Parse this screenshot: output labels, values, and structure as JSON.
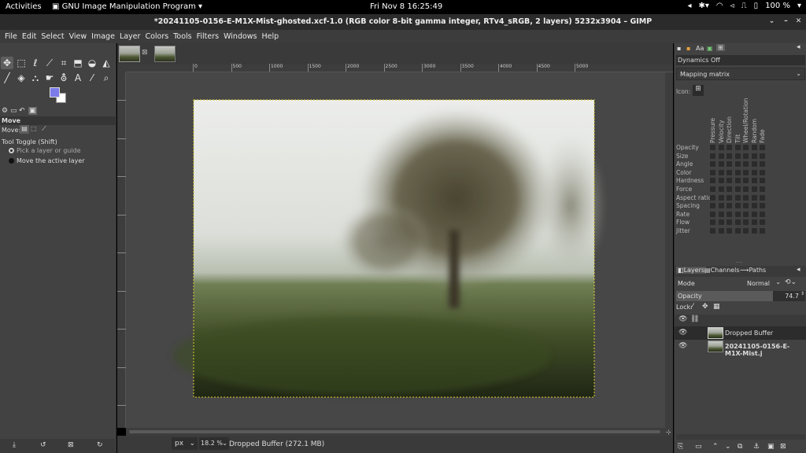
{
  "system_bar": {
    "activities": "Activities",
    "app_name": "GNU Image Manipulation Program",
    "clock": "Fri Nov 8  16:25:49",
    "battery": "100 %"
  },
  "window": {
    "title": "*20241105-0156-E-M1X-Mist-ghosted.xcf-1.0 (RGB color 8-bit gamma integer, RTv4_sRGB, 2 layers) 5232x3904 – GIMP"
  },
  "menu": [
    "File",
    "Edit",
    "Select",
    "View",
    "Image",
    "Layer",
    "Colors",
    "Tools",
    "Filters",
    "Windows",
    "Help"
  ],
  "tool_options": {
    "title": "Move",
    "move_label": "Move:",
    "toggle_label": "Tool Toggle  (Shift)",
    "option1": "Pick a layer or guide",
    "option2": "Move the active layer"
  },
  "ruler_ticks": [
    "0",
    "500",
    "1000",
    "1500",
    "2000",
    "2500",
    "3000",
    "3500",
    "4000",
    "4500",
    "5000"
  ],
  "status": {
    "unit": "px",
    "zoom": "18.2 %",
    "message": "Dropped Buffer (272.1 MB)"
  },
  "paint_dynamics": {
    "name": "Dynamics Off",
    "mode": "Mapping matrix",
    "icon_label": "Icon:",
    "columns": [
      "Pressure",
      "Velocity",
      "Direction",
      "Tilt",
      "Wheel/Rotation",
      "Random",
      "Fade"
    ],
    "rows": [
      "Opacity",
      "Size",
      "Angle",
      "Color",
      "Hardness",
      "Force",
      "Aspect ratio",
      "Spacing",
      "Rate",
      "Flow",
      "Jitter"
    ]
  },
  "layers_panel": {
    "tabs": [
      "Layers",
      "Channels",
      "Paths"
    ],
    "mode_label": "Mode",
    "mode_value": "Normal",
    "opacity_label": "Opacity",
    "opacity_value": "74.7",
    "opacity_fraction": 0.747,
    "lock_label": "Lock:",
    "layers": [
      {
        "name": "Dropped Buffer"
      },
      {
        "name": "20241105-0156-E-M1X-Mist.j"
      }
    ]
  },
  "colors": {
    "foreground": "#7b7bea",
    "background": "#ffffff",
    "selection": "#e0d030"
  }
}
